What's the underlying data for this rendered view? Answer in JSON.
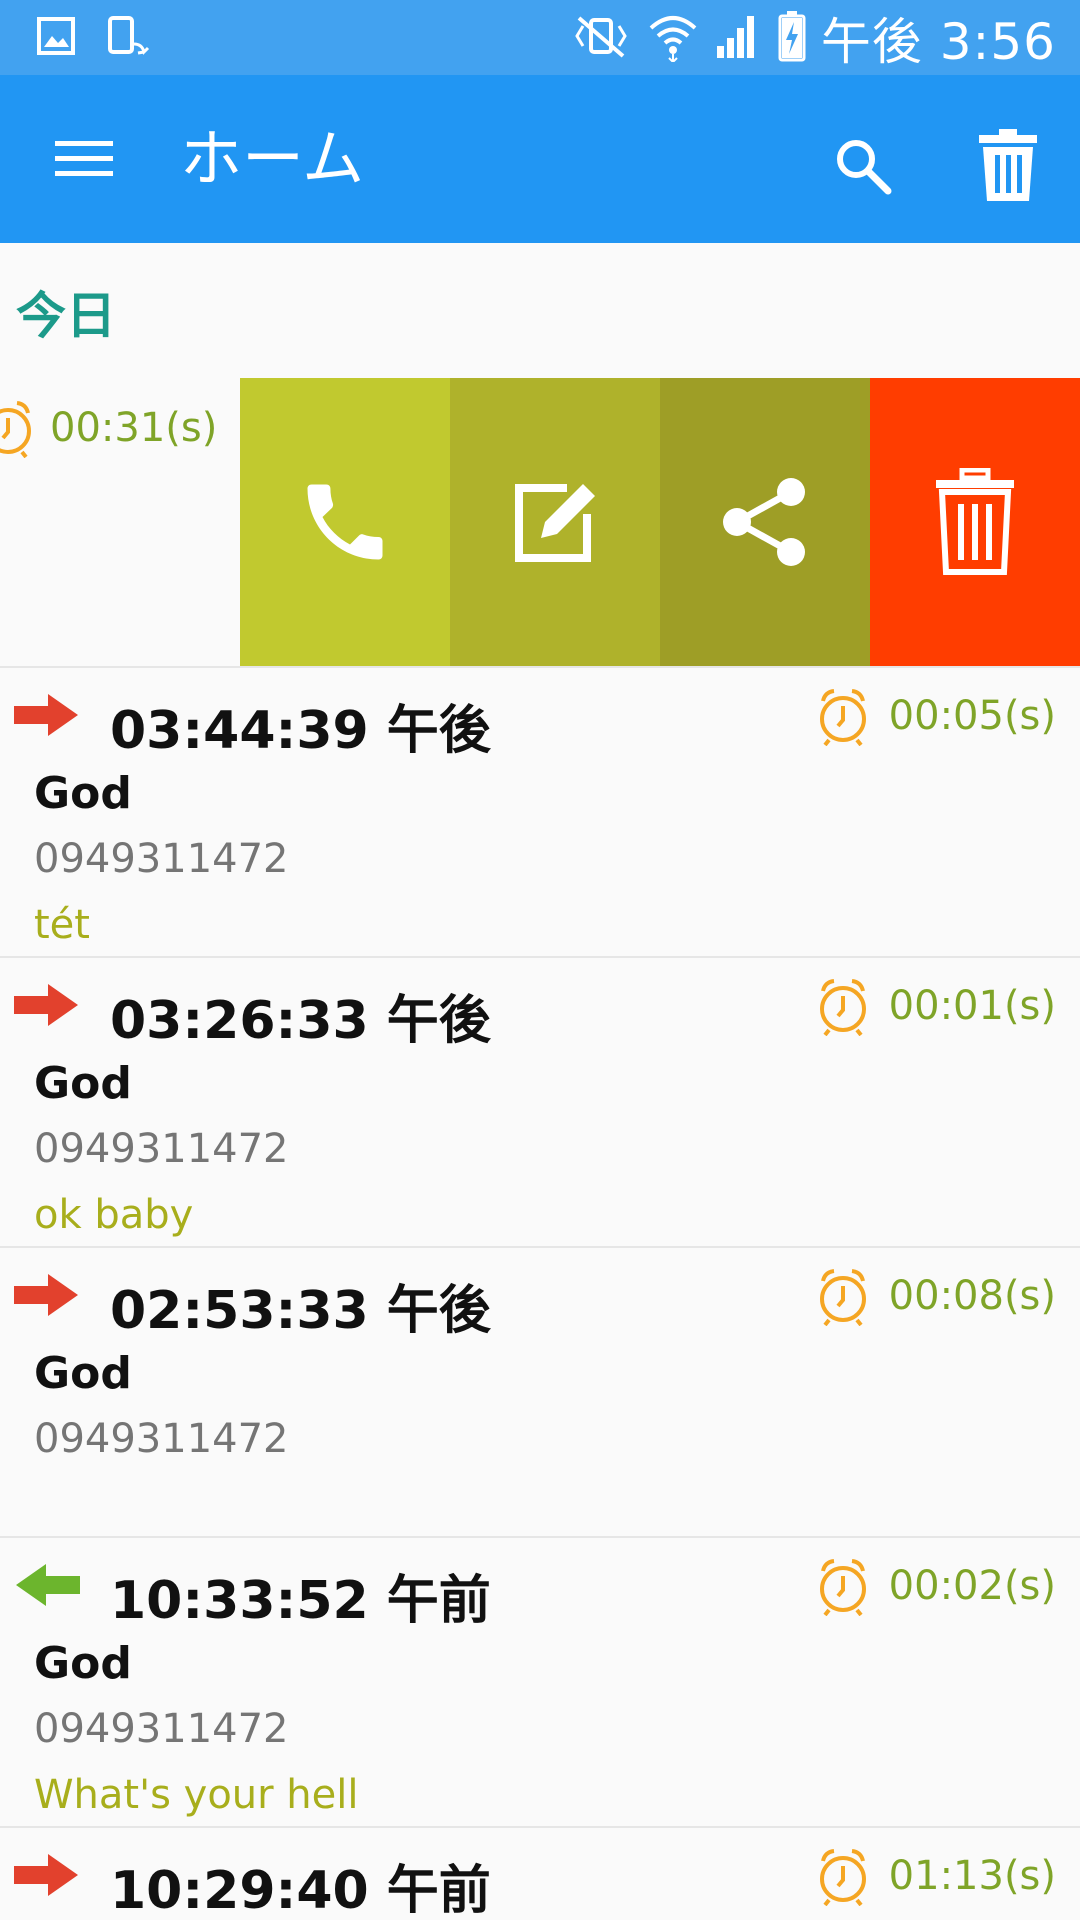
{
  "status_bar": {
    "time": "午後 3:56",
    "left_icons": [
      "gallery-icon",
      "screen-rotate-icon"
    ],
    "right_icons": [
      "vibrate-mute-icon",
      "wifi-icon",
      "signal-icon",
      "battery-charging-icon"
    ]
  },
  "app_bar": {
    "title": "ホーム",
    "menu_icon": "hamburger-menu-icon",
    "search_icon": "search-icon",
    "delete_icon": "trash-icon",
    "color": "#2196f3"
  },
  "section": {
    "title": "今日"
  },
  "swiped_item": {
    "duration": "00:31(s)",
    "actions": [
      {
        "name": "call",
        "icon": "phone-icon",
        "color": "#c1c92f"
      },
      {
        "name": "edit",
        "icon": "edit-icon",
        "color": "#afb22b"
      },
      {
        "name": "share",
        "icon": "share-icon",
        "color": "#9e9e26"
      },
      {
        "name": "delete",
        "icon": "trash-icon",
        "color": "#ff3d00"
      }
    ]
  },
  "calls": [
    {
      "direction": "outgoing",
      "time": "03:44:39 午後",
      "duration": "00:05(s)",
      "name": "God",
      "number": "0949311472",
      "note": "tét"
    },
    {
      "direction": "outgoing",
      "time": "03:26:33 午後",
      "duration": "00:01(s)",
      "name": "God",
      "number": "0949311472",
      "note": "ok baby"
    },
    {
      "direction": "outgoing",
      "time": "02:53:33 午後",
      "duration": "00:08(s)",
      "name": "God",
      "number": "0949311472",
      "note": ""
    },
    {
      "direction": "incoming",
      "time": "10:33:52 午前",
      "duration": "00:02(s)",
      "name": "God",
      "number": "0949311472",
      "note": "What's your hell"
    },
    {
      "direction": "outgoing",
      "time": "10:29:40 午前",
      "duration": "01:13(s)",
      "name": "",
      "number": "",
      "note": ""
    }
  ],
  "colors": {
    "outgoing_arrow": "#e2412d",
    "incoming_arrow": "#6cb52d",
    "alarm_icon": "#f5a623",
    "duration_text": "#7fa428",
    "note_text": "#a8ae1c",
    "section_title": "#1c9a8a"
  }
}
